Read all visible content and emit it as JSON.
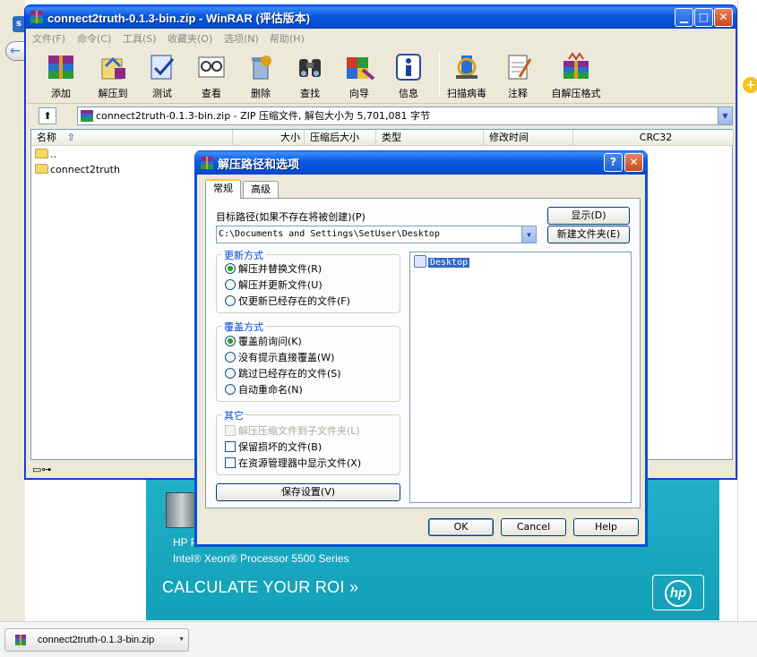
{
  "winrar": {
    "title": "connect2truth-0.1.3-bin.zip - WinRAR (评估版本)",
    "menu": [
      "文件(F)",
      "命令(C)",
      "工具(S)",
      "收藏夹(O)",
      "选项(N)",
      "帮助(H)"
    ],
    "toolbar": [
      "添加",
      "解压到",
      "测试",
      "查看",
      "删除",
      "查找",
      "向导",
      "信息",
      "扫描病毒",
      "注释",
      "自解压格式"
    ],
    "address": "connect2truth-0.1.3-bin.zip - ZIP 压缩文件, 解包大小为 5,701,081 字节",
    "columns": [
      "名称",
      "大小",
      "压缩后大小",
      "类型",
      "修改时间",
      "CRC32"
    ],
    "rows": [
      "..",
      "connect2truth"
    ]
  },
  "dialog": {
    "title": "解压路径和选项",
    "tabs": [
      "常规",
      "高级"
    ],
    "dest_label": "目标路径(如果不存在将被创建)(P)",
    "dest_value": "C:\\Documents and Settings\\SetUser\\Desktop",
    "show_button": "显示(D)",
    "new_folder_button": "新建文件夹(E)",
    "update_group": {
      "title": "更新方式",
      "options": [
        "解压并替换文件(R)",
        "解压并更新文件(U)",
        "仅更新已经存在的文件(F)"
      ],
      "selected": 0
    },
    "overwrite_group": {
      "title": "覆盖方式",
      "options": [
        "覆盖前询问(K)",
        "没有提示直接覆盖(W)",
        "跳过已经存在的文件(S)",
        "自动重命名(N)"
      ],
      "selected": 0
    },
    "other_group": {
      "title": "其它",
      "options": [
        "解压压缩文件到子文件夹(L)",
        "保留损坏的文件(B)",
        "在资源管理器中显示文件(X)"
      ]
    },
    "save_button": "保存设置(V)",
    "tree_item": "Desktop",
    "ok": "OK",
    "cancel": "Cancel",
    "help": "Help"
  },
  "ad": {
    "line1": "HP P",
    "line2": "Intel® Xeon® Processor 5500 Series",
    "cta": "CALCULATE YOUR ROI  »",
    "logo": "hp"
  },
  "taskbar": {
    "item": "connect2truth-0.1.3-bin.zip"
  },
  "browser": {
    "left_tab": "s"
  },
  "colors": {
    "xp_blue": "#0a58dc",
    "ad_teal": "#1fb0c7",
    "selection": "#316ac5"
  }
}
